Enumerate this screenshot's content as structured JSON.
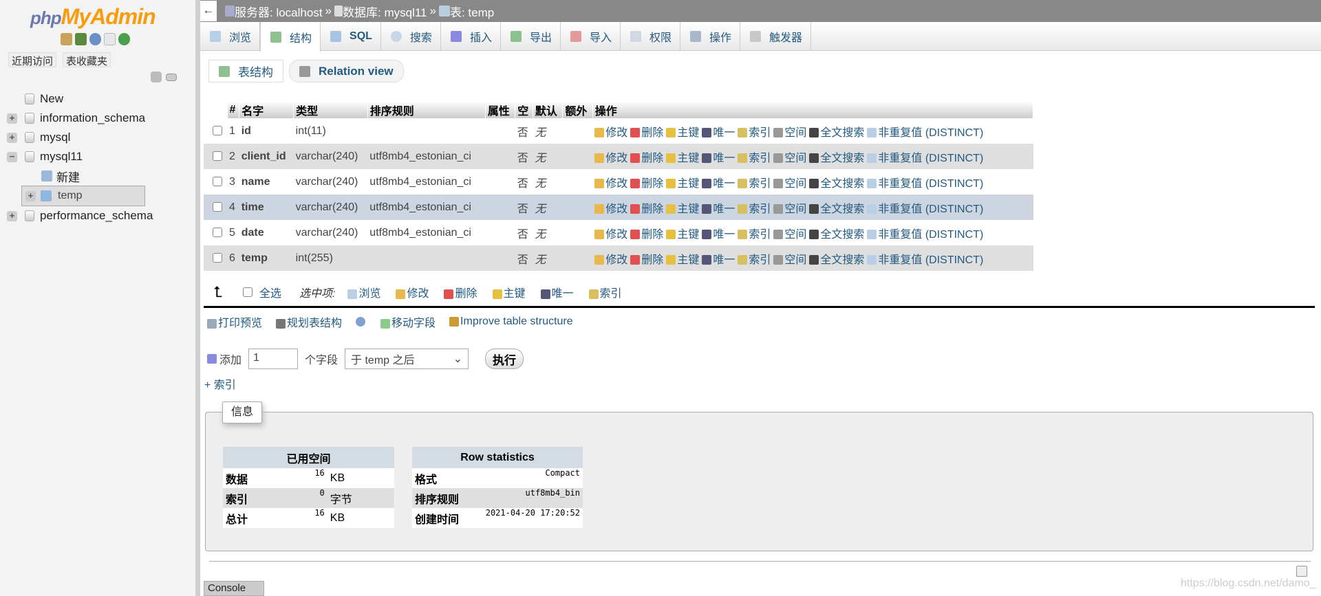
{
  "sidebar": {
    "logo": {
      "php": "php",
      "my": "MyAdmin"
    },
    "quick_icons": [
      "home-icon",
      "logout-icon",
      "help-icon",
      "docs-icon",
      "reload-icon"
    ],
    "recent": "近期访问",
    "favorites": "表收藏夹",
    "tree": [
      {
        "label": "New",
        "expander": ""
      },
      {
        "label": "information_schema",
        "expander": "+"
      },
      {
        "label": "mysql",
        "expander": "+"
      },
      {
        "label": "mysql11",
        "expander": "−"
      },
      {
        "label": "新建",
        "expander": ""
      },
      {
        "label": "temp",
        "expander": "+",
        "selected": true
      },
      {
        "label": "performance_schema",
        "expander": "+"
      }
    ]
  },
  "breadcrumb": {
    "server": "服务器: localhost",
    "db": "数据库: mysql11",
    "table": "表: temp",
    "sep": "»",
    "back": "←"
  },
  "tabs": [
    "浏览",
    "结构",
    "SQL",
    "搜索",
    "插入",
    "导出",
    "导入",
    "权限",
    "操作",
    "触发器"
  ],
  "subtabs": [
    "表结构",
    "Relation view"
  ],
  "structure": {
    "headers": [
      "#",
      "名字",
      "类型",
      "排序规则",
      "属性",
      "空",
      "默认",
      "额外",
      "操作"
    ],
    "rows": [
      [
        "1",
        "id",
        "int(11)",
        "",
        "",
        "否",
        "无"
      ],
      [
        "2",
        "client_id",
        "varchar(240)",
        "utf8mb4_estonian_ci",
        "",
        "否",
        "无"
      ],
      [
        "3",
        "name",
        "varchar(240)",
        "utf8mb4_estonian_ci",
        "",
        "否",
        "无"
      ],
      [
        "4",
        "time",
        "varchar(240)",
        "utf8mb4_estonian_ci",
        "",
        "否",
        "无"
      ],
      [
        "5",
        "date",
        "varchar(240)",
        "utf8mb4_estonian_ci",
        "",
        "否",
        "无"
      ],
      [
        "6",
        "temp",
        "int(255)",
        "",
        "",
        "否",
        "无"
      ]
    ],
    "actions": [
      "修改",
      "删除",
      "主键",
      "唯一",
      "索引",
      "空间",
      "全文搜索",
      "非重复值 (DISTINCT)"
    ],
    "highlighted_row": 4
  },
  "bulk": {
    "check_all": "全选",
    "with_selected": "选中项:",
    "actions": [
      "浏览",
      "修改",
      "删除",
      "主键",
      "唯一",
      "索引"
    ]
  },
  "tools": [
    "打印预览",
    "规划表结构",
    "移动字段",
    "Improve table structure"
  ],
  "add": {
    "label": "添加",
    "count": "1",
    "fields": "个字段",
    "position": "于 temp 之后",
    "go": "执行",
    "add_index": "+ 索引"
  },
  "info": {
    "legend": "信息",
    "space": {
      "title": "已用空间",
      "rows": [
        [
          "数据",
          "16",
          "KB"
        ],
        [
          "索引",
          "0",
          "字节"
        ],
        [
          "总计",
          "16",
          "KB"
        ]
      ]
    },
    "stats": {
      "title": "Row statistics",
      "rows": [
        [
          "格式",
          "Compact"
        ],
        [
          "排序规则",
          "utf8mb4_bin"
        ],
        [
          "创建时间",
          "2021-04-20 17:20:52"
        ]
      ]
    }
  },
  "console": "Console",
  "watermark": "https://blog.csdn.net/damo_",
  "colors": {
    "link": "#235a81",
    "topbar": "#888888",
    "highlight_row": "#ccd5e0"
  }
}
